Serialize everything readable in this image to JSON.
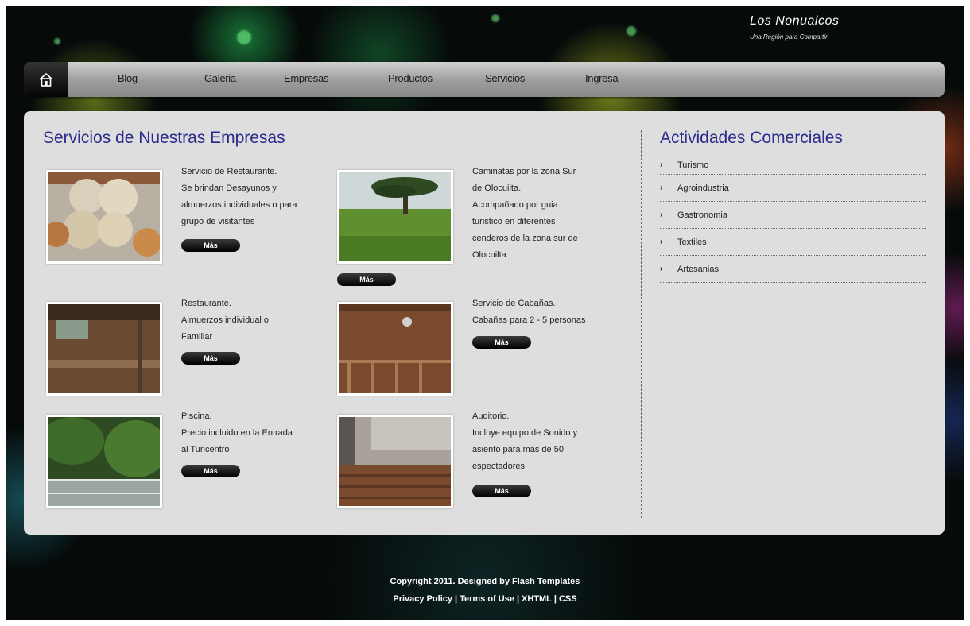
{
  "brand": {
    "title": "Los Nonualcos",
    "tagline": "Una Región para Compartir"
  },
  "nav": {
    "items": [
      "Blog",
      "Galeria",
      "Empresas",
      "Productos",
      "Servicios",
      "Ingresa"
    ]
  },
  "main": {
    "heading": "Servicios de Nuestras Empresas",
    "more_label": "Más",
    "services": [
      {
        "text": "Servicio de Restaurante.\nSe brindan Desayunos y\nalmuerzos individuales o para\ngrupo de visitantes",
        "image": "tortillas-photo"
      },
      {
        "text": "Caminatas por la zona Sur\nde Olocuilta.\nAcompañado por guia\nturistico en diferentes\ncenderos de la zona sur de\nOlocuilta",
        "image": "tree-field-photo"
      },
      {
        "text": "Restaurante.\nAlmuerzos individual o\nFamiliar",
        "image": "restaurant-photo"
      },
      {
        "text": "Servicio de Cabañas.\nCabañas para 2 - 5 personas",
        "image": "cabin-photo"
      },
      {
        "text": "Piscina.\nPrecio incluido en la Entrada\nal Turicentro",
        "image": "pool-photo"
      },
      {
        "text": "Auditorio.\nIncluye equipo de Sonido y\nasiento para mas de 50\nespectadores",
        "image": "auditorium-photo"
      }
    ]
  },
  "sidebar": {
    "heading": "Actividades Comerciales",
    "items": [
      "Turismo",
      "Agroindustria",
      "Gastronomia",
      "Textiles",
      "Artesanias"
    ]
  },
  "footer": {
    "copyright": "Copyright 2011. Designed by Flash Templates",
    "links": [
      "Privacy Policy",
      "Terms of Use",
      "XHTML",
      "CSS"
    ]
  }
}
